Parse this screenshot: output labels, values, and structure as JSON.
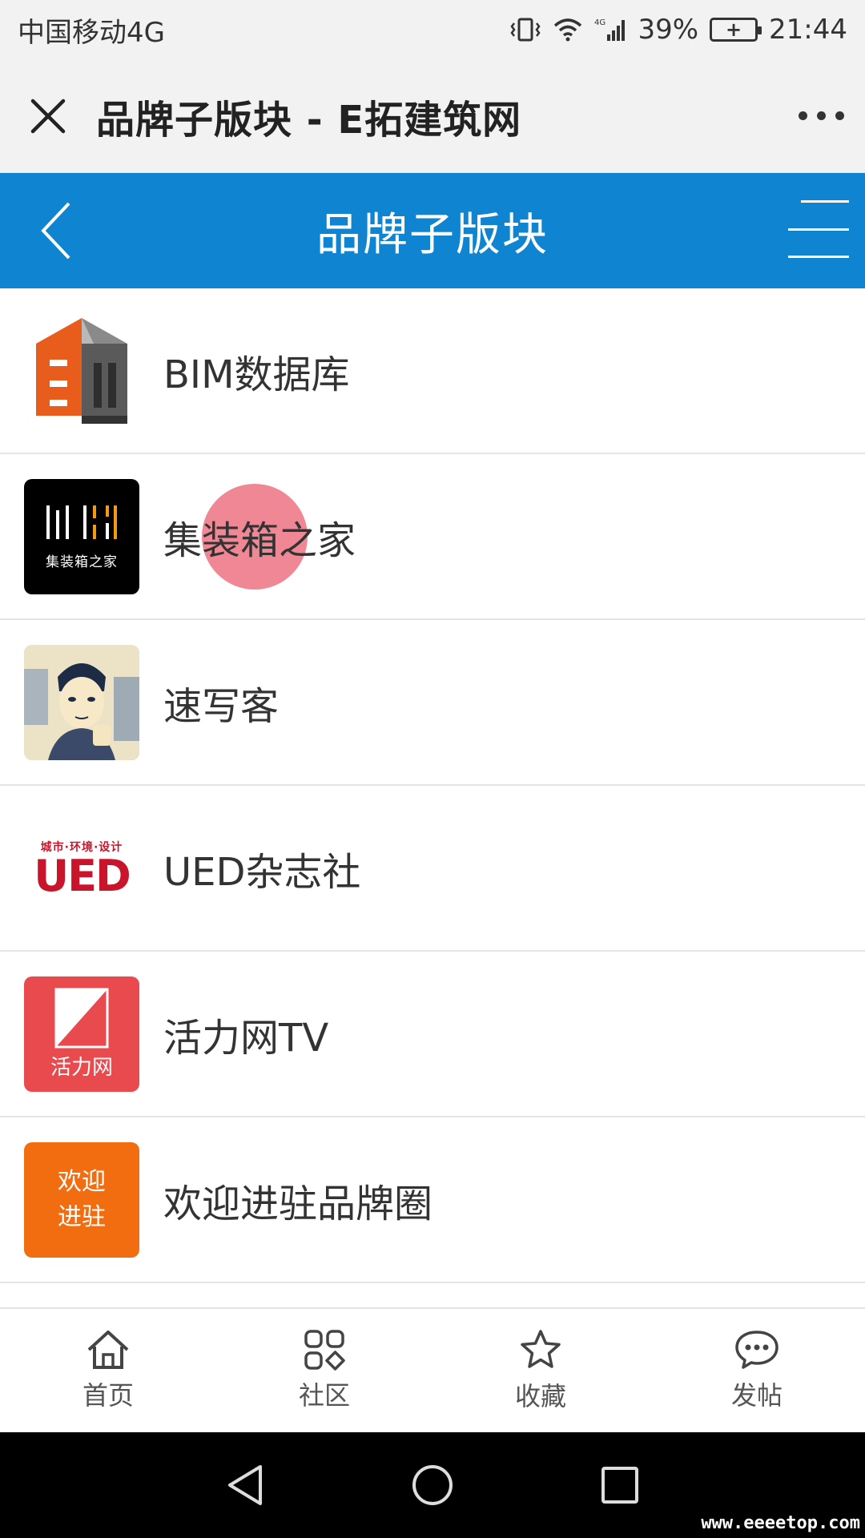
{
  "status_bar": {
    "carrier": "中国移动4G",
    "battery": "39%",
    "time": "21:44"
  },
  "app_bar": {
    "title": "品牌子版块 - E拓建筑网"
  },
  "header": {
    "title": "品牌子版块"
  },
  "list": {
    "items": [
      {
        "label": "BIM数据库",
        "icon": "bim-logo"
      },
      {
        "label": "集装箱之家",
        "icon": "container-home-logo",
        "thumb_text": "集装箱之家"
      },
      {
        "label": "速写客",
        "icon": "sketch-avatar"
      },
      {
        "label": "UED杂志社",
        "icon": "ued-logo",
        "thumb_top": "城市·环境·设计",
        "thumb_main": "UED"
      },
      {
        "label": "活力网TV",
        "icon": "huoli-logo",
        "thumb_text": "活力网"
      },
      {
        "label": "欢迎进驻品牌圈",
        "icon": "welcome-logo",
        "thumb_line1": "欢迎",
        "thumb_line2": "进驻"
      }
    ]
  },
  "tabs": [
    {
      "label": "首页",
      "icon": "home-icon"
    },
    {
      "label": "社区",
      "icon": "grid-icon"
    },
    {
      "label": "收藏",
      "icon": "star-icon"
    },
    {
      "label": "发帖",
      "icon": "chat-icon"
    }
  ],
  "watermark": "www.eeeetop.com",
  "colors": {
    "header_blue": "#0f84d0",
    "touch": "#e8465a",
    "orange": "#f26d10",
    "huoli_red": "#e84a4e"
  }
}
